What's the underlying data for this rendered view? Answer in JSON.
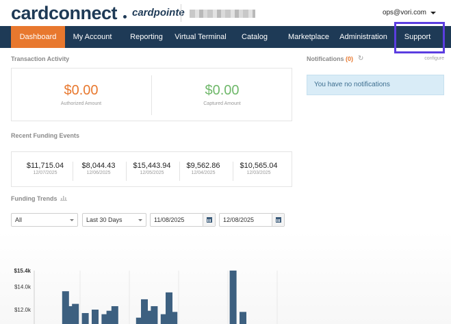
{
  "header": {
    "logo": "cardconnect",
    "logo_sub": "cardpointe",
    "user_email": "ops@vori.com"
  },
  "nav": {
    "items": [
      {
        "label": "Dashboard",
        "active": true
      },
      {
        "label": "My Account"
      },
      {
        "label": "Reporting"
      },
      {
        "label": "Virtual Terminal"
      },
      {
        "label": "Catalog"
      },
      {
        "label": "Marketplace"
      },
      {
        "label": "Administration"
      },
      {
        "label": "Support"
      }
    ]
  },
  "transaction_activity": {
    "title": "Transaction Activity",
    "authorized": {
      "amount": "$0.00",
      "label": "Authorized Amount",
      "color": "#e8782e"
    },
    "captured": {
      "amount": "$0.00",
      "label": "Captured Amount",
      "color": "#6fb86a"
    }
  },
  "notifications": {
    "title": "Notifications",
    "count": "(0)",
    "configure": "configure",
    "empty_message": "You have no notifications"
  },
  "recent_funding": {
    "title": "Recent Funding Events",
    "events": [
      {
        "amount": "$11,715.04",
        "date": "12/07/2025"
      },
      {
        "amount": "$8,044.43",
        "date": "12/06/2025"
      },
      {
        "amount": "$15,443.94",
        "date": "12/05/2025"
      },
      {
        "amount": "$9,562.86",
        "date": "12/04/2025"
      },
      {
        "amount": "$10,565.04",
        "date": "12/03/2025"
      }
    ]
  },
  "funding_trends": {
    "title": "Funding Trends",
    "filter_account": "All",
    "filter_range": "Last 30 Days",
    "date_from": "11/08/2025",
    "date_to": "12/08/2025"
  },
  "chart_data": {
    "type": "bar",
    "y_ticks": [
      "$15.4k",
      "$14.0k",
      "$12.0k"
    ],
    "y_tick_values": [
      15400,
      14000,
      12000
    ],
    "ylim": [
      11000,
      15400
    ],
    "values": [
      null,
      null,
      null,
      null,
      13600,
      12300,
      12500,
      null,
      11700,
      null,
      12000,
      null,
      11600,
      11900,
      12300,
      null,
      null,
      null,
      null,
      11300,
      12900,
      11900,
      12300,
      null,
      11600,
      13500,
      11800,
      null,
      null,
      null,
      null,
      null,
      null,
      null,
      null,
      null,
      null,
      null,
      15400,
      null,
      11800
    ],
    "bar_color": "#3d6080",
    "grid": true
  },
  "colors": {
    "nav_bg": "#1e3a56",
    "nav_active": "#e8782e",
    "highlight": "#5b3de0"
  }
}
